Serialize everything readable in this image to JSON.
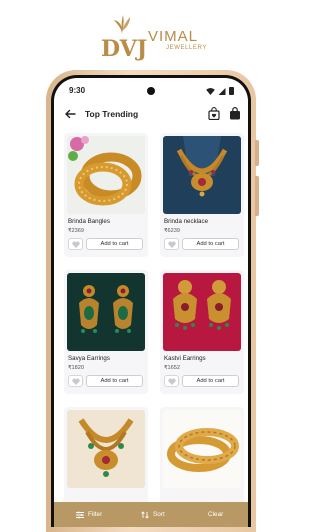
{
  "brand": {
    "monogram": "DVJ",
    "name": "VIMAL",
    "tagline": "JEWELLERY",
    "color": "#b98c48"
  },
  "status_bar": {
    "time": "9:30"
  },
  "header": {
    "title": "Top Trending",
    "icons": [
      "back-arrow-icon",
      "wishlist-bag-icon",
      "shopping-bag-icon"
    ]
  },
  "products": [
    {
      "name": "Brinda Bangles",
      "price": "₹2369",
      "cart_label": "Add to cart",
      "image": "gold-bangles-photo"
    },
    {
      "name": "Brinda necklace",
      "price": "₹6239",
      "cart_label": "Add to cart",
      "image": "gold-necklace-photo"
    },
    {
      "name": "Savya Earrings",
      "price": "₹1820",
      "cart_label": "Add to cart",
      "image": "emerald-earrings-photo"
    },
    {
      "name": "Kastvi Earrings",
      "price": "₹1652",
      "cart_label": "Add to cart",
      "image": "ruby-earrings-photo"
    },
    {
      "name": "",
      "price": "",
      "cart_label": "",
      "image": "temple-necklace-photo"
    },
    {
      "name": "",
      "price": "",
      "cart_label": "",
      "image": "gold-bangle-pair-photo"
    }
  ],
  "bottom_bar": {
    "filter_label": "Filter",
    "sort_label": "Sort",
    "clear_label": "Clear",
    "color": "#b89864"
  }
}
